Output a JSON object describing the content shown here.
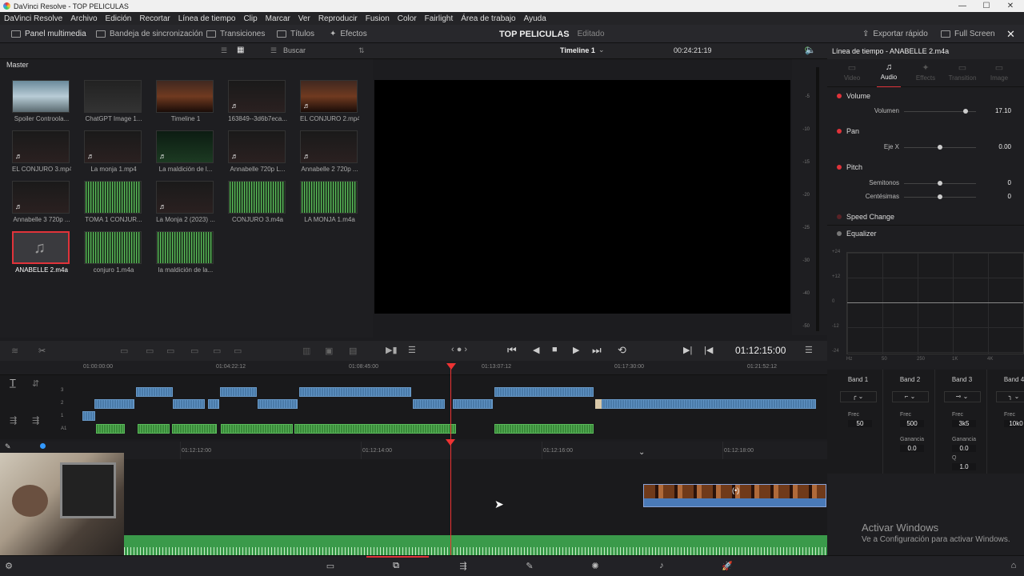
{
  "window": {
    "title": "DaVinci Resolve - TOP PELICULAS"
  },
  "menu": [
    "DaVinci Resolve",
    "Archivo",
    "Edición",
    "Recortar",
    "Línea de tiempo",
    "Clip",
    "Marcar",
    "Ver",
    "Reproducir",
    "Fusion",
    "Color",
    "Fairlight",
    "Área de trabajo",
    "Ayuda"
  ],
  "toolbar": {
    "media_pool": "Panel multimedia",
    "sync_bin": "Bandeja de sincronización",
    "transitions": "Transiciones",
    "titles": "Títulos",
    "effects": "Efectos",
    "project_name": "TOP PELICULAS",
    "project_status": "Editado",
    "quick_export": "Exportar rápido",
    "full_screen": "Full Screen"
  },
  "media_pool": {
    "search_label": "Buscar",
    "bin": "Master",
    "clips": [
      {
        "name": "Spoiler Controola...",
        "kind": "still1"
      },
      {
        "name": "ChatGPT Image 1...",
        "kind": "still2"
      },
      {
        "name": "Timeline 1",
        "kind": "warm"
      },
      {
        "name": "163849--3d6b7eca...",
        "kind": "dark",
        "badge": "♬"
      },
      {
        "name": "EL CONJURO 2.mp4",
        "kind": "warm",
        "badge": "♬"
      },
      {
        "name": "EL CONJURO 3.mp4",
        "kind": "dark",
        "badge": "♬"
      },
      {
        "name": "La monja 1.mp4",
        "kind": "dark",
        "badge": "♬"
      },
      {
        "name": "La maldición de l...",
        "kind": "green",
        "badge": "♬"
      },
      {
        "name": "Annabelle 720p L...",
        "kind": "dark",
        "badge": "♬"
      },
      {
        "name": "Annabelle 2 720p ...",
        "kind": "dark",
        "badge": "♬"
      },
      {
        "name": "Annabelle 3 720p ...",
        "kind": "dark",
        "badge": "♬"
      },
      {
        "name": "TOMA 1 CONJUR...",
        "kind": "wave"
      },
      {
        "name": "La Monja 2 (2023) ...",
        "kind": "dark",
        "badge": "♬"
      },
      {
        "name": "CONJURO 3.m4a",
        "kind": "wave"
      },
      {
        "name": "LA MONJA 1.m4a",
        "kind": "wave"
      },
      {
        "name": "ANABELLE 2.m4a",
        "kind": "sel"
      },
      {
        "name": "conjuro 1.m4a",
        "kind": "wave"
      },
      {
        "name": "la maldición de la...",
        "kind": "wave"
      }
    ]
  },
  "viewer": {
    "timeline_name": "Timeline 1",
    "duration": "00:24:21:19",
    "timecode": "01:12:15:00"
  },
  "meter_ticks": [
    "-5",
    "-10",
    "-15",
    "-20",
    "-25",
    "-30",
    "-40",
    "-50"
  ],
  "ruler1": [
    "01:00:00:00",
    "01:04:22:12",
    "01:08:45:00",
    "01:13:07:12",
    "01:17:30:00",
    "01:21:52:12"
  ],
  "ruler2": [
    "01:12:12:00",
    "01:12:14:00",
    "01:12:16:00",
    "01:12:18:00"
  ],
  "track_labels": [
    "3",
    "2",
    "1",
    "A1"
  ],
  "inspector": {
    "title": "Línea de tiempo - ANABELLE 2.m4a",
    "tabs": [
      "Video",
      "Audio",
      "Effects",
      "Transition",
      "Image"
    ],
    "active_tab": "Audio",
    "volume": {
      "section": "Volume",
      "label": "Volumen",
      "value": "17.10",
      "level": 0.85
    },
    "pan": {
      "section": "Pan",
      "label": "Eje X",
      "value": "0.00",
      "level": 0.5
    },
    "pitch": {
      "section": "Pitch",
      "semitones_label": "Semitonos",
      "semitones": "0",
      "cents_label": "Centésimas",
      "cents": "0",
      "level": 0.5
    },
    "speed_change": "Speed Change",
    "equalizer": "Equalizer",
    "eq_y": [
      "+24",
      "+12",
      "0",
      "-12",
      "-24"
    ],
    "eq_x": [
      "Hz",
      "50",
      "250",
      "1K",
      "4K"
    ],
    "bands": [
      {
        "name": "Band 1",
        "freq_label": "Frec",
        "freq": "50"
      },
      {
        "name": "Band 2",
        "freq_label": "Frec",
        "freq": "500",
        "gain_label": "Ganancia",
        "gain": "0.0"
      },
      {
        "name": "Band 3",
        "freq_label": "Frec",
        "freq": "3k5",
        "gain_label": "Ganancia",
        "gain": "0.0",
        "q_label": "Q",
        "q": "1.0"
      },
      {
        "name": "Band 4",
        "freq_label": "Frec",
        "freq": "10k0"
      }
    ]
  },
  "watermark": {
    "line1": "Activar Windows",
    "line2": "Ve a Configuración para activar Windows."
  },
  "colors": {
    "accent": "#e0333a",
    "video_clip": "#4a7aa8",
    "audio_clip": "#3a8a3a"
  }
}
